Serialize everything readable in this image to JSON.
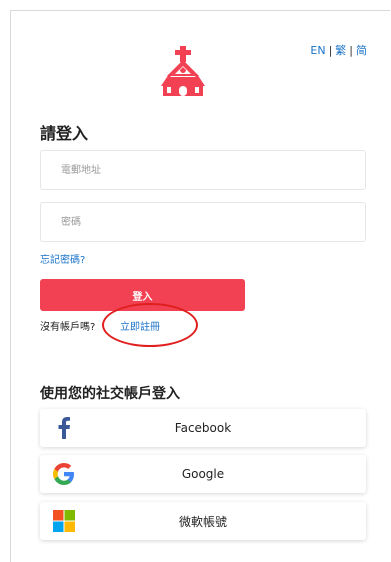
{
  "language": {
    "en": "EN",
    "traditional": "繁",
    "simplified": "简",
    "separator": "|"
  },
  "login": {
    "heading": "請登入",
    "email_placeholder": "電郵地址",
    "password_placeholder": "密碼",
    "forgot_password": "忘記密碼?",
    "login_button": "登入",
    "no_account_text": "沒有帳戶嗎?",
    "register_link": "立即註冊"
  },
  "social": {
    "heading": "使用您的社交帳戶登入",
    "buttons": [
      {
        "label": "Facebook",
        "icon": "facebook-icon"
      },
      {
        "label": "Google",
        "icon": "google-icon"
      },
      {
        "label": "微軟帳號",
        "icon": "microsoft-icon"
      }
    ]
  },
  "colors": {
    "accent": "#f24152",
    "link": "#1a73c8",
    "annotation_circle": "#e01f1f"
  }
}
